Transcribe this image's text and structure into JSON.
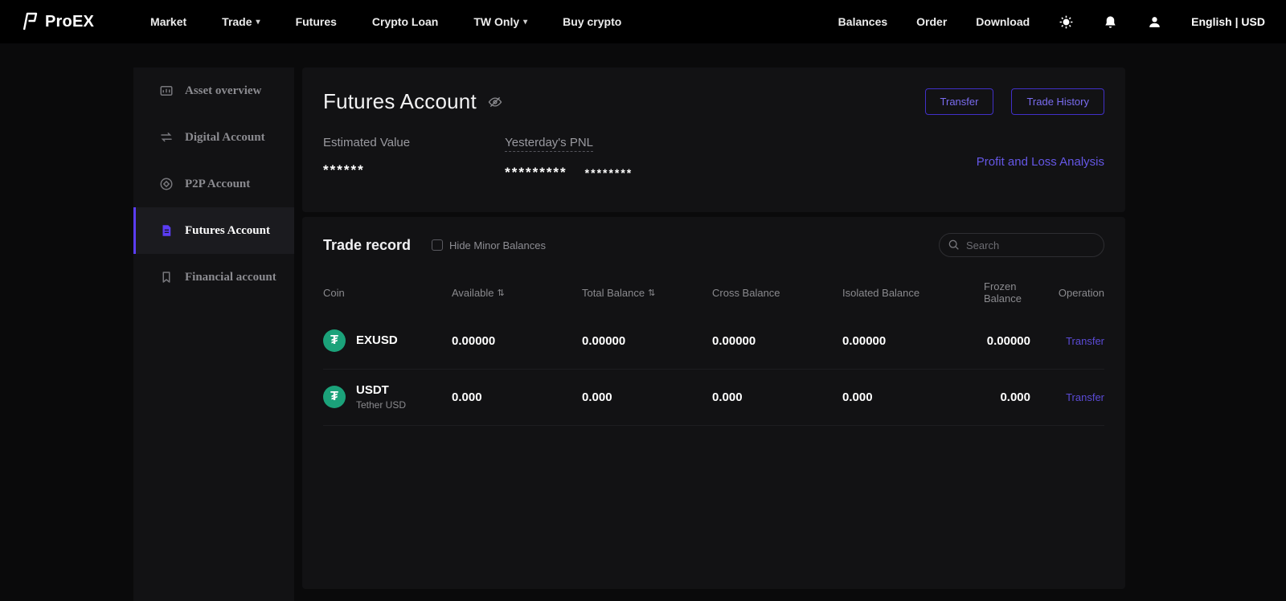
{
  "icons": {
    "caret": "▾",
    "sort": "⇅",
    "tether": "₮"
  },
  "navbar": {
    "brand": "ProEX",
    "items": [
      "Market",
      "Trade",
      "Futures",
      "Crypto Loan",
      "TW Only",
      "Buy crypto"
    ],
    "right_items": [
      "Balances",
      "Order",
      "Download"
    ],
    "locale": "English | USD"
  },
  "sidebar": {
    "items": [
      "Asset overview",
      "Digital Account",
      "P2P Account",
      "Futures Account",
      "Financial account"
    ]
  },
  "account": {
    "title": "Futures Account",
    "transfer_label": "Transfer",
    "trade_history_label": "Trade History",
    "estimated_value_label": "Estimated Value",
    "estimated_value": "******",
    "pnl_label": "Yesterday's PNL",
    "pnl_value_main": "*********",
    "pnl_value_sub": "********",
    "pnl_link": "Profit and Loss Analysis"
  },
  "trade_record": {
    "title": "Trade record",
    "hide_minor_label": "Hide Minor Balances",
    "search_placeholder": "Search",
    "columns": {
      "coin": "Coin",
      "available": "Available",
      "total": "Total Balance",
      "cross": "Cross Balance",
      "isolated": "Isolated Balance",
      "frozen": "Frozen Balance",
      "operation": "Operation"
    },
    "rows": [
      {
        "coin": "EXUSD",
        "subtitle": "",
        "available": "0.00000",
        "total": "0.00000",
        "cross": "0.00000",
        "isolated": "0.00000",
        "frozen": "0.00000",
        "operation": "Transfer"
      },
      {
        "coin": "USDT",
        "subtitle": "Tether USD",
        "available": "0.000",
        "total": "0.000",
        "cross": "0.000",
        "isolated": "0.000",
        "frozen": "0.000",
        "operation": "Transfer"
      }
    ]
  },
  "colors": {
    "accent": "#5b3df5",
    "link": "#6557e6",
    "tether_green": "#1ba27a"
  }
}
